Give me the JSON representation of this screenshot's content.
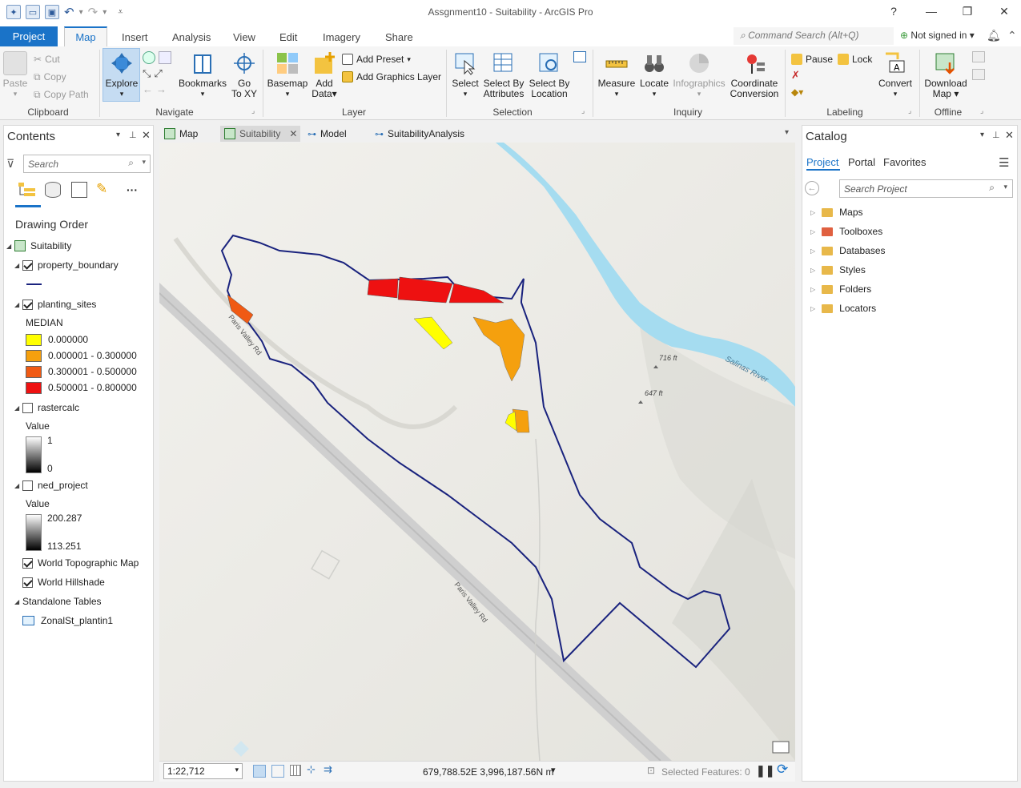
{
  "window": {
    "title": "Assgnment10 - Suitability - ArcGIS Pro",
    "help": "?",
    "min": "—",
    "max": "❐",
    "close": "✕"
  },
  "ribbon_tabs": [
    "Project",
    "Map",
    "Insert",
    "Analysis",
    "View",
    "Edit",
    "Imagery",
    "Share"
  ],
  "command_search": {
    "placeholder": "Command Search (Alt+Q)"
  },
  "signin": "Not signed in",
  "clipboard": {
    "group": "Clipboard",
    "paste": "Paste",
    "cut": "Cut",
    "copy": "Copy",
    "copy_path": "Copy Path"
  },
  "navigate": {
    "group": "Navigate",
    "explore": "Explore",
    "bookmarks": "Bookmarks",
    "goto": "Go",
    "goto2": "To XY"
  },
  "layer": {
    "group": "Layer",
    "basemap": "Basemap",
    "add_data": "Add",
    "add_data2": "Data",
    "add_preset": "Add Preset",
    "add_graphics": "Add Graphics Layer"
  },
  "selection": {
    "group": "Selection",
    "select": "Select",
    "by_attr1": "Select By",
    "by_attr2": "Attributes",
    "by_loc1": "Select By",
    "by_loc2": "Location"
  },
  "inquiry": {
    "group": "Inquiry",
    "measure": "Measure",
    "locate": "Locate",
    "infographics": "Infographics",
    "coord1": "Coordinate",
    "coord2": "Conversion"
  },
  "labeling": {
    "group": "Labeling",
    "pause": "Pause",
    "lock": "Lock",
    "convert": "Convert"
  },
  "offline": {
    "group": "Offline",
    "download1": "Download",
    "download2": "Map"
  },
  "contents": {
    "title": "Contents",
    "search_placeholder": "Search",
    "drawing_order": "Drawing Order",
    "map_name": "Suitability",
    "layers": {
      "property_boundary": "property_boundary",
      "planting_sites": "planting_sites",
      "median_label": "MEDIAN",
      "legend": [
        {
          "label": "0.000000",
          "color": "#ffff00"
        },
        {
          "label": "0.000001 - 0.300000",
          "color": "#f5a00e"
        },
        {
          "label": "0.300001 - 0.500000",
          "color": "#f05a14"
        },
        {
          "label": "0.500001 - 0.800000",
          "color": "#ee1111"
        }
      ],
      "rastercalc": "rastercalc",
      "value1": "Value",
      "rc_max": "1",
      "rc_min": "0",
      "ned_project": "ned_project",
      "value2": "Value",
      "ned_max": "200.287",
      "ned_min": "113.251",
      "topo": "World Topographic Map",
      "hillshade": "World Hillshade",
      "standalone": "Standalone Tables",
      "table": "ZonalSt_plantin1"
    }
  },
  "view_tabs": [
    "Map",
    "Suitability",
    "Model",
    "SuitabilityAnalysis"
  ],
  "map_labels": {
    "river": "Salinas River",
    "road1": "Paris Valley Rd",
    "road2": "Paris Valley Rd",
    "elev1": "716 ft",
    "elev2": "647 ft"
  },
  "status": {
    "scale": "1:22,712",
    "coords": "679,788.52E 3,996,187.56N m",
    "selected": "Selected Features: 0"
  },
  "catalog": {
    "title": "Catalog",
    "tabs": [
      "Project",
      "Portal",
      "Favorites"
    ],
    "search_placeholder": "Search Project",
    "items": [
      "Maps",
      "Toolboxes",
      "Databases",
      "Styles",
      "Folders",
      "Locators"
    ]
  }
}
